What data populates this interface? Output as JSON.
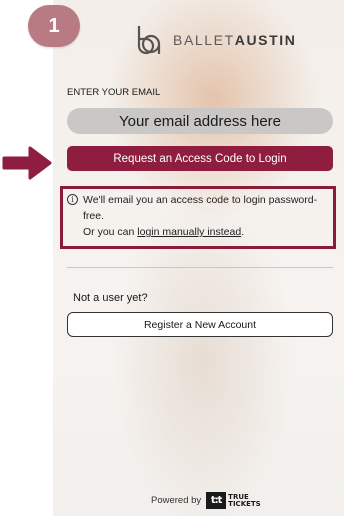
{
  "step_badge": "1",
  "logo": {
    "brand_light": "BALLET",
    "brand_bold": "AUSTIN"
  },
  "form": {
    "email_label": "ENTER YOUR EMAIL",
    "email_placeholder": "Your email address here",
    "access_button": "Request an Access Code to Login"
  },
  "info": {
    "line1": "We'll email you an access code to login password-free.",
    "line2_prefix": "Or you can ",
    "line2_link": "login manually instead",
    "line2_suffix": "."
  },
  "signup": {
    "prompt": "Not a user yet?",
    "register_button": "Register a New Account"
  },
  "footer": {
    "powered_by": "Powered by",
    "provider_mark": "t:t",
    "provider_word1": "TRUE",
    "provider_word2": "TICKETS"
  },
  "colors": {
    "primary": "#8f1d3f",
    "highlight_border": "#8a1c3a",
    "badge": "#b97b83"
  }
}
